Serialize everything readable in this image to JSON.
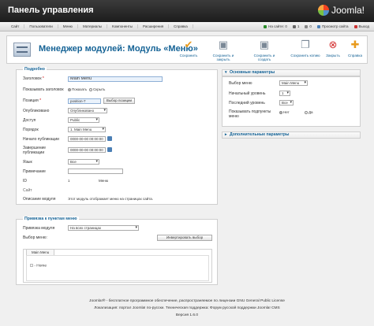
{
  "header": {
    "title": "Панель управления",
    "logo_text": "Joomla!"
  },
  "menu": [
    "Сайт",
    "Пользователи",
    "Меню",
    "Материалы",
    "Компоненты",
    "Расширения",
    "Справка"
  ],
  "status": {
    "visitors": "На сайте: 0",
    "admins": "1",
    "messages": "0",
    "preview": "Просмотр сайта",
    "logout": "Выход"
  },
  "toolbar": {
    "title": "Менеджер модулей: Модуль «Меню»",
    "buttons": [
      "Сохранить",
      "Сохранить и закрыть",
      "Сохранить и создать",
      "Сохранить копию",
      "Закрыть",
      "Справка"
    ]
  },
  "details": {
    "legend": "Подробно",
    "title_label": "Заголовок",
    "title_value": "Main Menu",
    "show_title_label": "Показывать заголовок",
    "show_option": "Показать",
    "hide_option": "Скрыть",
    "position_label": "Позиция",
    "position_value": "position-7",
    "position_button": "Выбор позиции",
    "published_label": "Опубликовано",
    "published_value": "Опубликовано",
    "access_label": "Доступ",
    "access_value": "Public",
    "order_label": "Порядок",
    "order_value": "1. Main Menu",
    "start_label": "Начало публикации",
    "start_value": "0000-00-00 00:00:00",
    "end_label": "Завершение публикации",
    "end_value": "0000-00-00 00:00:00",
    "language_label": "Язык",
    "language_value": "Все",
    "note_label": "Примечание",
    "id_label": "ID",
    "id_value": "1",
    "type_value": "Меню",
    "site_label": "Сайт",
    "desc_label": "Описание модуля",
    "desc_value": "Этот модуль отображает меню на страницах сайта."
  },
  "assign": {
    "legend": "Привязка к пунктам меню",
    "module_label": "Привязка модуля",
    "module_value": "На всех страницах",
    "select_label": "Выбор меню:",
    "invert_button": "Инвертировать выбор",
    "tab": "Main Menu",
    "item": "- Home"
  },
  "basic": {
    "title": "Основные параметры",
    "menu_label": "Выбор меню",
    "menu_value": "Main Menu",
    "start_level_label": "Начальный уровень",
    "start_level_value": "1",
    "end_level_label": "Последний уровень",
    "end_level_value": "Все",
    "show_sub_label": "Показывать подпункты меню",
    "yes": "Нет",
    "no": "Да"
  },
  "advanced": {
    "title": "Дополнительные параметры"
  },
  "footer": {
    "line1": "Joomla!® - бесплатное программное обеспечение, распространяемое по лицензии GNU General Public License",
    "line2": "Локализация: портал Joomla! по-русски. Техническая поддержка: Форум русской поддержки Joomla! CMS",
    "line3": "Версия 1.6.0"
  }
}
